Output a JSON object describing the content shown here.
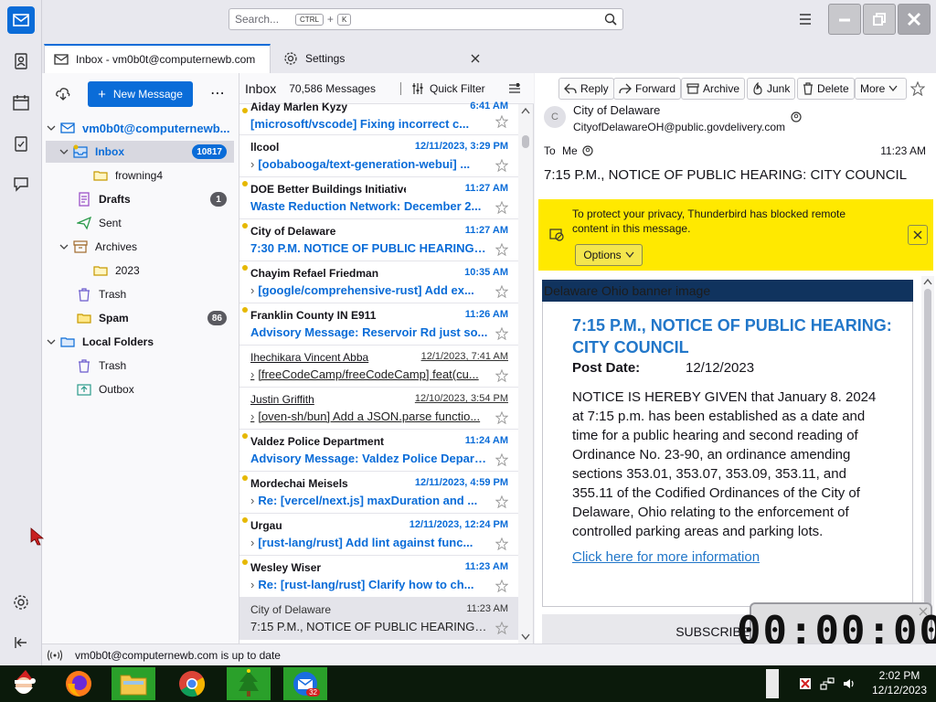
{
  "search": {
    "placeholder": "Search...",
    "key_ctrl": "CTRL",
    "plus": "+",
    "key_k": "K"
  },
  "tabs": [
    {
      "label": "Inbox - vm0b0t@computernewb.com"
    },
    {
      "label": "Settings"
    }
  ],
  "folders": {
    "new_message": "New Message",
    "account": "vm0b0t@computernewb...",
    "items": [
      {
        "label": "Inbox",
        "count": "10817"
      },
      {
        "label": "frowning4"
      },
      {
        "label": "Drafts",
        "count": "1"
      },
      {
        "label": "Sent"
      },
      {
        "label": "Archives"
      },
      {
        "label": "2023"
      },
      {
        "label": "Trash"
      },
      {
        "label": "Spam",
        "count": "86"
      },
      {
        "label": "Local Folders"
      },
      {
        "label": "Trash"
      },
      {
        "label": "Outbox"
      }
    ]
  },
  "list": {
    "folder_name": "Inbox",
    "count": "70,586 Messages",
    "quick_filter": "Quick Filter",
    "messages": [
      {
        "sender": "Aiday Marlen Kyzy",
        "date": "6:41 AM",
        "subject": "[microsoft/vscode] Fixing incorrect c..."
      },
      {
        "sender": "llcool",
        "date": "12/11/2023, 3:29 PM",
        "subject": "[oobabooga/text-generation-webui] ..."
      },
      {
        "sender": "DOE Better Buildings Initiative",
        "date": "11:27 AM",
        "subject": "Waste Reduction Network: December 2..."
      },
      {
        "sender": "City of Delaware",
        "date": "11:27 AM",
        "subject": "7:30 P.M. NOTICE OF PUBLIC HEARING: ..."
      },
      {
        "sender": "Chayim Refael Friedman",
        "date": "10:35 AM",
        "subject": "[google/comprehensive-rust] Add ex..."
      },
      {
        "sender": "Franklin County IN E911",
        "date": "11:26 AM",
        "subject": "Advisory Message: Reservoir Rd just so..."
      },
      {
        "sender": "Ihechikara Vincent Abba",
        "date": "12/1/2023, 7:41 AM",
        "subject": "[freeCodeCamp/freeCodeCamp] feat(cu..."
      },
      {
        "sender": "Justin Griffith",
        "date": "12/10/2023, 3:54 PM",
        "subject": "[oven-sh/bun] Add a JSON.parse functio..."
      },
      {
        "sender": "Valdez Police Department",
        "date": "11:24 AM",
        "subject": "Advisory Message: Valdez Police Depart..."
      },
      {
        "sender": "Mordechai Meisels",
        "date": "12/11/2023, 4:59 PM",
        "subject": "Re: [vercel/next.js] maxDuration and ..."
      },
      {
        "sender": "Urgau",
        "date": "12/11/2023, 12:24 PM",
        "subject": "[rust-lang/rust] Add lint against func..."
      },
      {
        "sender": "Wesley Wiser",
        "date": "11:23 AM",
        "subject": "Re: [rust-lang/rust] Clarify how to ch..."
      },
      {
        "sender": "City of Delaware",
        "date": "11:23 AM",
        "subject": "7:15 P.M., NOTICE OF PUBLIC HEARING: CIT..."
      }
    ]
  },
  "reader": {
    "buttons": {
      "reply": "Reply",
      "forward": "Forward",
      "archive": "Archive",
      "junk": "Junk",
      "delete": "Delete",
      "more": "More"
    },
    "avatar_letter": "C",
    "from_name": "City of Delaware",
    "from_email": "CityofDelawareOH@public.govdelivery.com",
    "to_label": "To",
    "to_value": "Me",
    "time": "11:23 AM",
    "subject": "7:15 P.M., NOTICE OF PUBLIC HEARING: CITY COUNCIL",
    "privacy_text": "To protect your privacy, Thunderbird has blocked remote content in this message.",
    "options": "Options",
    "banner_alt": "Delaware Ohio banner image",
    "body_title": "7:15 P.M., NOTICE OF PUBLIC HEARING: CITY COUNCIL",
    "post_date_label": "Post Date:",
    "post_date": "12/12/2023",
    "body_text": "NOTICE IS HEREBY GIVEN that January 8. 2024 at 7:15 p.m. has been established as a date and time for a public hearing and second reading of Ordinance No. 23-90, an ordinance amending sections 353.01, 353.07, 353.09, 353.11, and 355.11 of the Codified Ordinances of the City of Delaware, Ohio relating to the enforcement of controlled parking areas and parking lots.",
    "link": "Click here for more information",
    "subscriber": "SUBSCRIBER SE"
  },
  "status": {
    "text": "vm0b0t@computernewb.com is up to date"
  },
  "taskbar": {
    "time": "2:02 PM",
    "date": "12/12/2023",
    "mail_badge": "32"
  },
  "timer": {
    "value": "00:00:00"
  },
  "colors": {
    "accent": "#0a6cd8",
    "privacy_bar": "#ffe900",
    "unread_dot": "#e6b800"
  }
}
